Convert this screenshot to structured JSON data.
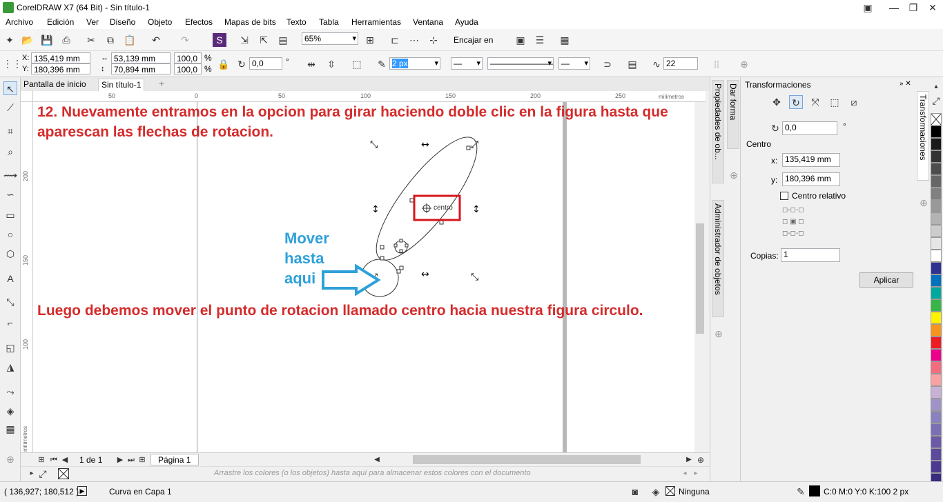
{
  "window": {
    "title": "CorelDRAW X7 (64 Bit) - Sin título-1"
  },
  "menu": [
    "Archivo",
    "Edición",
    "Ver",
    "Diseño",
    "Objeto",
    "Efectos",
    "Mapas de bits",
    "Texto",
    "Tabla",
    "Herramientas",
    "Ventana",
    "Ayuda"
  ],
  "toolbar": {
    "zoom": "65%",
    "snap": "Encajar en"
  },
  "props": {
    "x": "135,419 mm",
    "y": "180,396 mm",
    "w": "53,139 mm",
    "h": "70,894 mm",
    "sx": "100,0",
    "sy": "100,0",
    "pct1": "%",
    "pct2": "%",
    "rotation": "0,0",
    "deg": "°",
    "outline": "2 px",
    "smooth": "22"
  },
  "tabs": {
    "home": "Pantalla de inicio",
    "doc": "Sin título-1",
    "add": "+"
  },
  "ruler": {
    "unit": "milímetros",
    "h_ticks": [
      "50",
      "0",
      "50",
      "100",
      "150",
      "200",
      "250"
    ],
    "v_ticks": [
      "200",
      "150",
      "100"
    ]
  },
  "annotations": {
    "step": "12. Nuevamente entramos en la opcion para girar haciendo doble clic en la figura hasta que aparescan las flechas de rotacion.",
    "move": [
      "Mover",
      "hasta",
      "aqui"
    ],
    "bottom": "Luego debemos mover el punto de rotacion llamado centro hacia nuestra figura circulo.",
    "center_label": "centro"
  },
  "pagenav": {
    "pages": "1 de 1",
    "page": "Página 1"
  },
  "colorbar": {
    "hint": "Arrastre los colores (o los objetos) hasta aquí para almacenar estos colores con el documento"
  },
  "docker": {
    "tab_props": "Propiedades de ob...",
    "tab_shape": "Dar forma",
    "tab_objects": "Administrador de objetos",
    "tab_transform": "Transformaciones",
    "title": "Transformaciones",
    "angle": "0,0",
    "deg": "°",
    "center_label": "Centro",
    "x_label": "x:",
    "x_val": "135,419 mm",
    "y_label": "y:",
    "y_val": "180,396 mm",
    "relative": "Centro relativo",
    "copies_label": "Copias:",
    "copies_val": "1",
    "apply": "Aplicar"
  },
  "palette": [
    "#ffffff",
    "#000000",
    "#1a1a1a",
    "#333333",
    "#4d4d4d",
    "#666666",
    "#808080",
    "#999999",
    "#b3b3b3",
    "#cccccc",
    "#e6e6e6",
    "#ffffff",
    "#2e3192",
    "#0071bc",
    "#00a99d",
    "#39b54a",
    "#fff200",
    "#f7941d",
    "#ed1c24",
    "#ec008c",
    "#f26d7d",
    "#f9a1a3",
    "#c7b2d6",
    "#a093c7",
    "#8a82bf",
    "#7b6fb5",
    "#6a5aa8",
    "#5c4a9c",
    "#4b3a8f",
    "#3a2a80",
    "#f0f0f0"
  ],
  "status": {
    "coords": "( 136,927; 180,512 )",
    "layer": "Curva en Capa 1",
    "fill": "Ninguna",
    "outline": "C:0 M:0 Y:0 K:100  2 px"
  }
}
